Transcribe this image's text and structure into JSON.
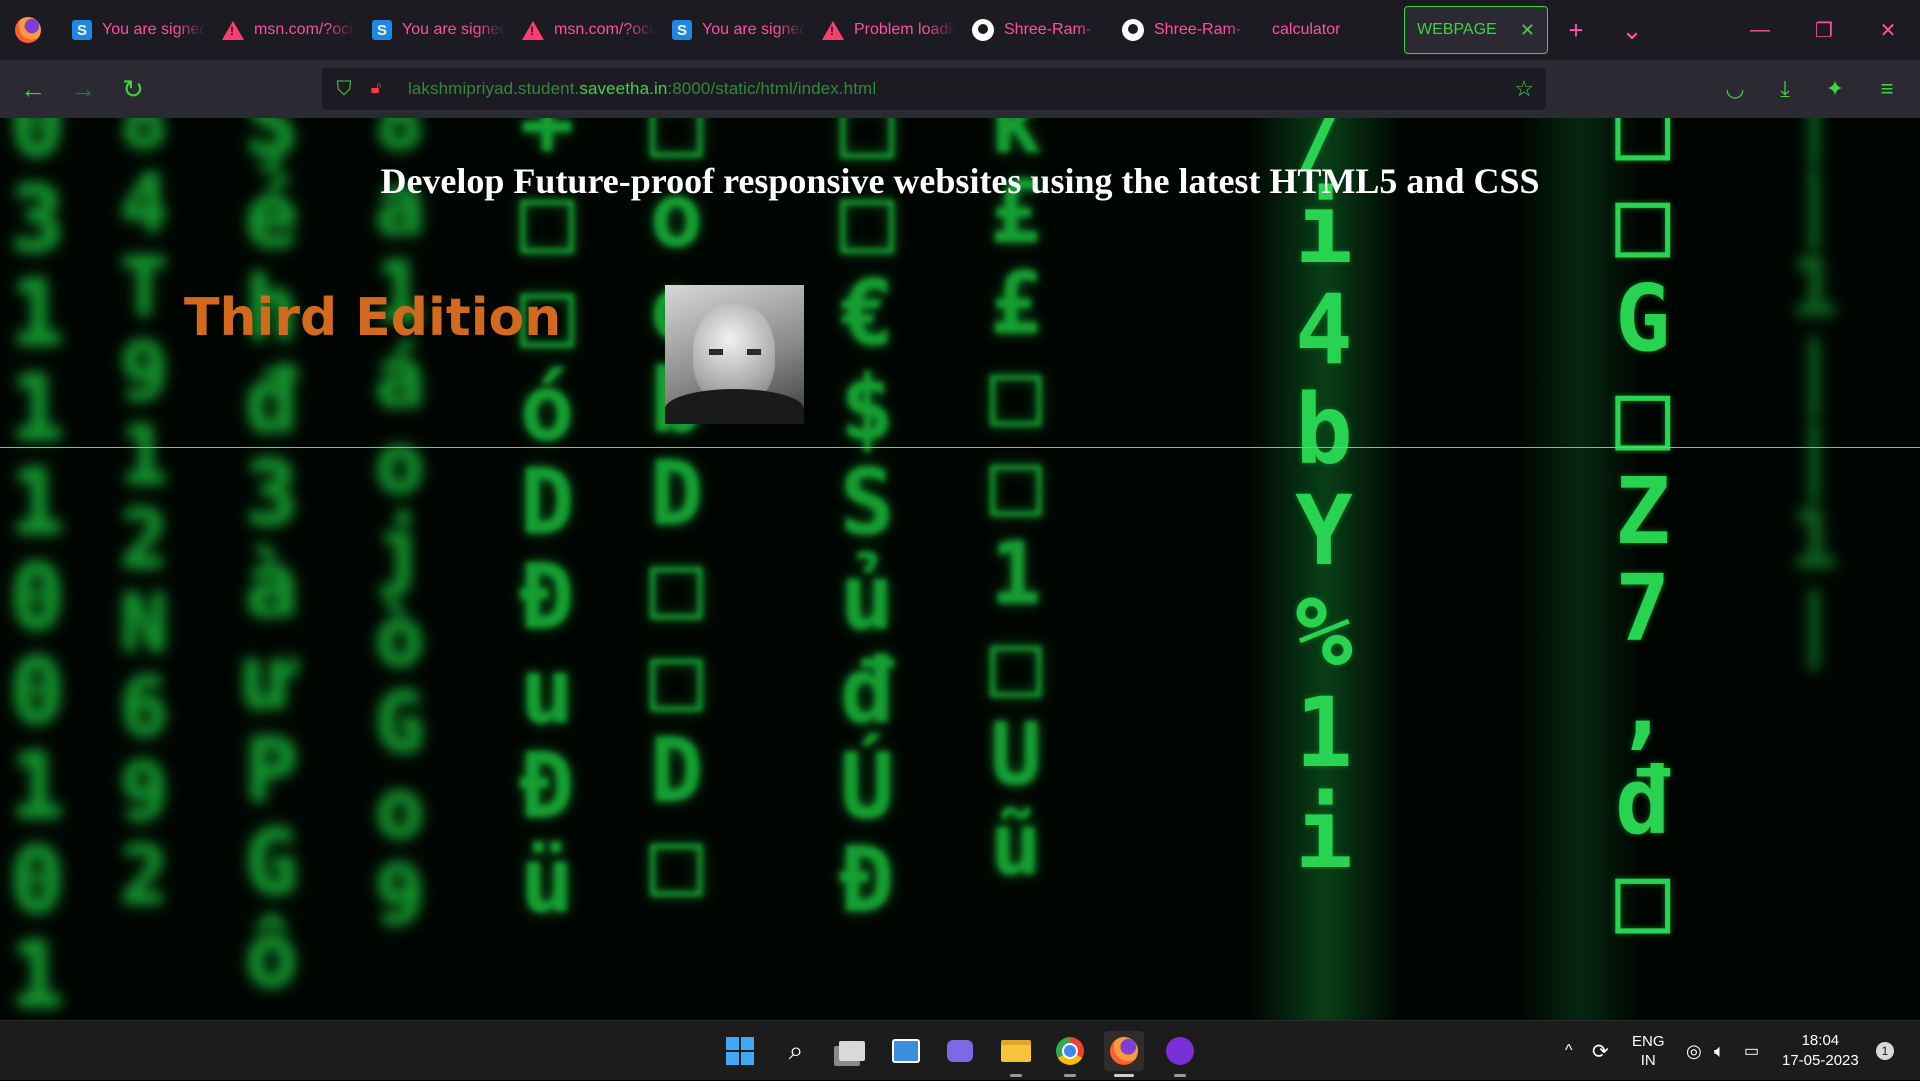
{
  "browser": {
    "tabs": [
      {
        "icon": "s-icon",
        "label": "You are signed in"
      },
      {
        "icon": "warning-icon",
        "label": "msn.com/?ocid"
      },
      {
        "icon": "s-icon",
        "label": "You are signed in"
      },
      {
        "icon": "warning-icon",
        "label": "msn.com/?ocid"
      },
      {
        "icon": "s-icon",
        "label": "You are signed in"
      },
      {
        "icon": "warning-icon",
        "label": "Problem loading page"
      },
      {
        "icon": "github-icon",
        "label": "Shree-Ram-"
      },
      {
        "icon": "github-icon",
        "label": "Shree-Ram-"
      },
      {
        "icon": "none",
        "label": "calculator"
      }
    ],
    "active_tab": {
      "label": "WEBPAGE",
      "close": "✕"
    },
    "new_tab": "+",
    "tab_list": "⌄",
    "url": {
      "prefix": "lakshmipriyad.student.",
      "domain": "saveetha.in",
      "suffix": ":8000/static/html/index.html"
    }
  },
  "page": {
    "heading": "Develop Future-proof responsive websites using the latest HTML5 and CSS",
    "edition": "Third Edition"
  },
  "taskbar": {
    "lang_top": "ENG",
    "lang_bottom": "IN",
    "time": "18:04",
    "date": "17-05-2023",
    "notification_count": "1"
  },
  "colors": {
    "accent": "#3fd33f",
    "tab_text": "#ff4fa3",
    "edition": "#d2691e",
    "rule": "#c9a06a"
  }
}
